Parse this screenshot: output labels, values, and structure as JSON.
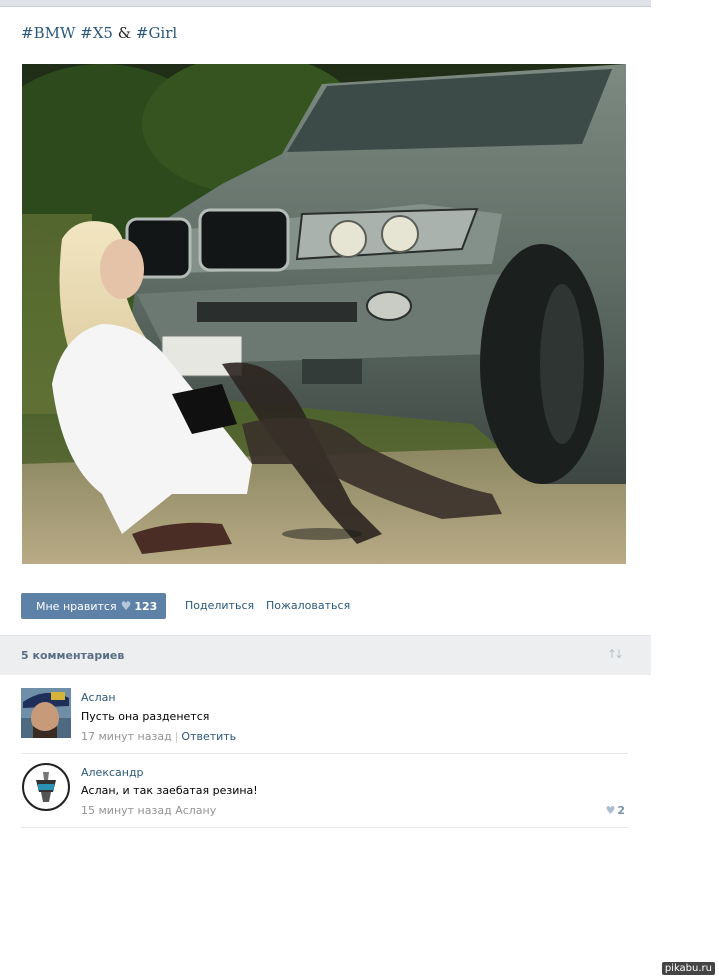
{
  "post": {
    "title_tag1": "#BMW",
    "title_tag2": "#X5",
    "title_amp": "&",
    "title_tag3": "#Girl"
  },
  "actions": {
    "like_label": "Мне нравится",
    "like_count": "123",
    "share_label": "Поделиться",
    "report_label": "Пожаловаться"
  },
  "comments_header": {
    "count_label": "5 комментариев",
    "sort_icon": "sort-arrows-icon"
  },
  "comments": [
    {
      "author": "Аслан",
      "text": "Пусть она разденется",
      "time": "17 минут назад",
      "reply_label": "Ответить",
      "sep": "|"
    },
    {
      "author": "Александр",
      "text": "Аслан, и так заебатая резина!",
      "time": "15 минут назад",
      "addressee": "Аслану",
      "likes": "2"
    }
  ],
  "watermark": "pikabu.ru",
  "colors": {
    "link": "#2b587a",
    "like_button": "#5e81a8",
    "comments_bar": "#edeef0"
  }
}
